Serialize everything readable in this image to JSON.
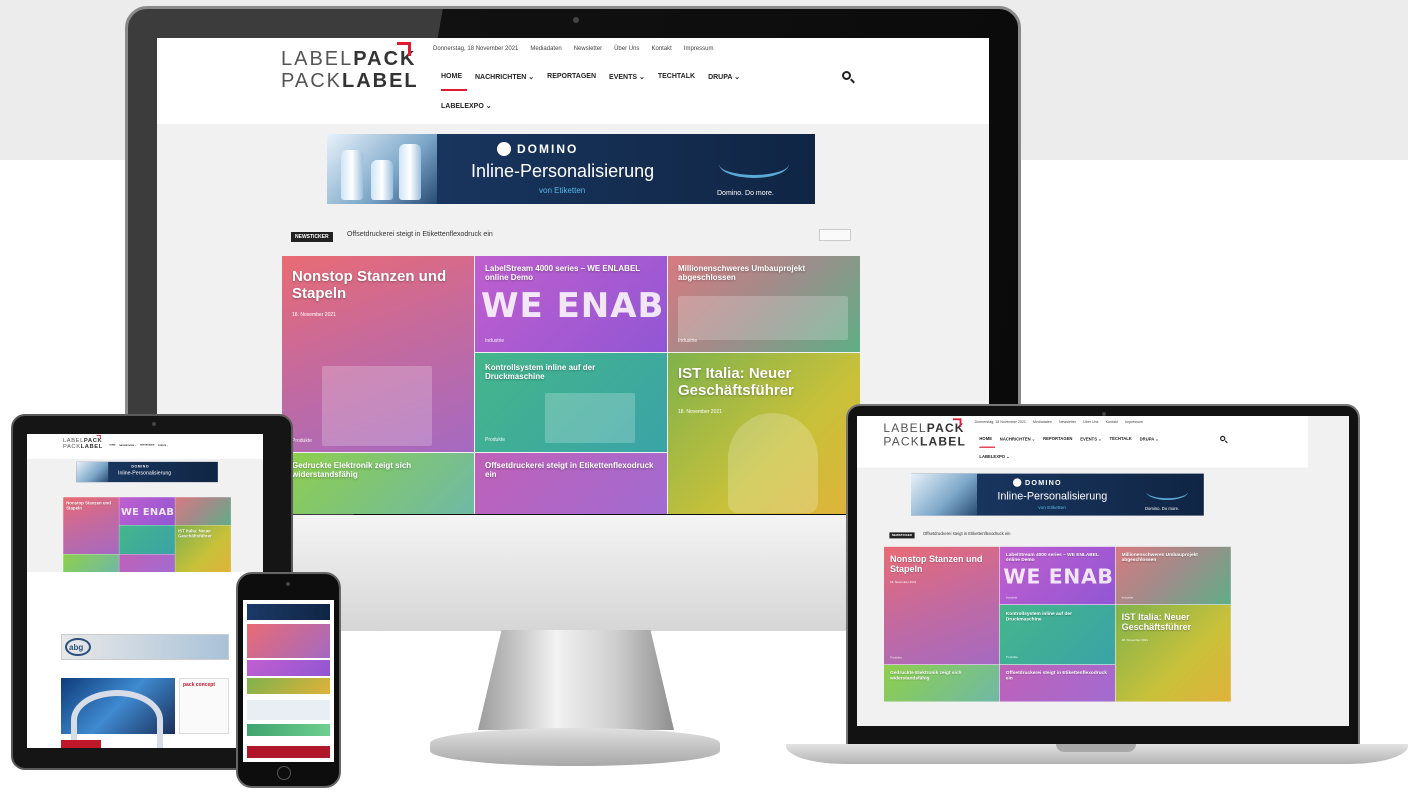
{
  "site": {
    "logo_line1_a": "LABEL",
    "logo_line1_b": "PACK",
    "logo_line2_a": "PACK",
    "logo_line2_b": "LABEL",
    "topbar": [
      "Donnerstag, 18 November 2021",
      "Mediadaten",
      "Newsletter",
      "Über Uns",
      "Kontakt",
      "Impressum"
    ],
    "nav": [
      "HOME",
      "NACHRICHTEN ⌄",
      "REPORTAGEN",
      "EVENTS ⌄",
      "TECHTALK",
      "DRUPA ⌄"
    ],
    "nav_second_row": "LABELEXPO ⌄",
    "banner": {
      "brand": "DOMINO",
      "title": "Inline-Personalisierung",
      "subtitle": "von Etiketten",
      "tagline": "Domino. Do more."
    },
    "ticker": {
      "label": "NEWSTICKER",
      "text": "Offsetdruckerei steigt in Etikettenflexodruck ein"
    },
    "tiles": [
      {
        "title": "Nonstop Stanzen und Stapeln",
        "date": "18. November 2021",
        "category": "Produkte"
      },
      {
        "title": "LabelStream 4000 series – WE ENLABEL online Demo",
        "overlay": "WE ENABLE",
        "category": "Industrie"
      },
      {
        "title": "Millionenschweres Umbauprojekt abgeschlossen",
        "category": "Industrie"
      },
      {
        "title": "Kontrollsystem inline auf der Druckmaschine",
        "category": "Produkte"
      },
      {
        "title": "IST Italia: Neuer Geschäftsführer",
        "date": "18. November 2021"
      },
      {
        "title": "Gedruckte Elektronik zeigt sich widerstandsfähig"
      },
      {
        "title": "Offsetdruckerei steigt in Etikettenflexodruck ein"
      }
    ]
  },
  "tablet_extras": {
    "ad_brand": "abg",
    "section_label": "pack concept"
  },
  "colors": {
    "accent_red": "#e0192e",
    "banner_navy": "#1b3a66",
    "banner_cyan": "#57b7e6"
  },
  "icons": {
    "search": "search-icon",
    "chevron": "chevron-down-icon"
  }
}
